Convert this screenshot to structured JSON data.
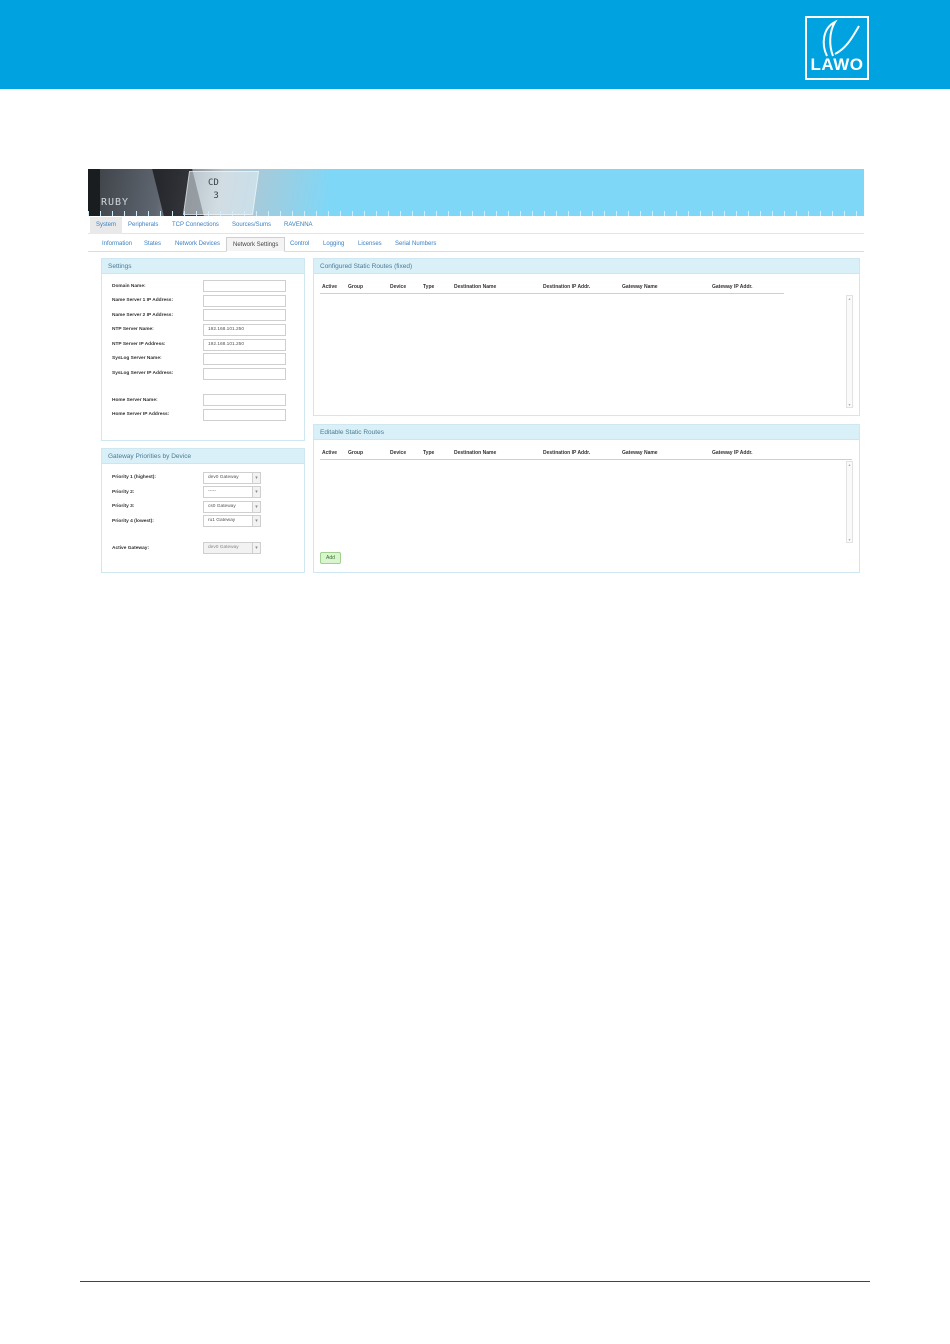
{
  "brand": {
    "logo_text": "LAWO",
    "band_color": "#00a3e0"
  },
  "banner": {
    "product": "RUBY",
    "photo_text_line1": "CD",
    "photo_text_line2": "3"
  },
  "main_tabs": [
    {
      "label": "System",
      "active": true
    },
    {
      "label": "Peripherals",
      "active": false
    },
    {
      "label": "TCP Connections",
      "active": false
    },
    {
      "label": "Sources/Sums",
      "active": false
    },
    {
      "label": "RAVENNA",
      "active": false
    }
  ],
  "sub_tabs": [
    {
      "label": "Information",
      "active": false
    },
    {
      "label": "States",
      "active": false
    },
    {
      "label": "Network Devices",
      "active": false
    },
    {
      "label": "Network Settings",
      "active": true
    },
    {
      "label": "Control",
      "active": false
    },
    {
      "label": "Logging",
      "active": false
    },
    {
      "label": "Licenses",
      "active": false
    },
    {
      "label": "Serial Numbers",
      "active": false
    }
  ],
  "settings": {
    "title": "Settings",
    "fields": [
      {
        "label": "Domain Name:",
        "value": ""
      },
      {
        "label": "Name Server 1 IP Address:",
        "value": ""
      },
      {
        "label": "Name Server 2 IP Address:",
        "value": ""
      },
      {
        "label": "NTP Server Name:",
        "value": "192.168.101.250"
      },
      {
        "label": "NTP Server IP Address:",
        "value": "192.168.101.250"
      },
      {
        "label": "SysLog Server Name:",
        "value": ""
      },
      {
        "label": "SysLog Server IP Address:",
        "value": ""
      },
      {
        "label": "Home Server Name:",
        "value": ""
      },
      {
        "label": "Home Server IP Address:",
        "value": ""
      }
    ]
  },
  "gateway": {
    "title": "Gateway Priorities by Device",
    "priorities": [
      {
        "label": "Priority 1 (highest):",
        "value": "dev0 Gateway"
      },
      {
        "label": "Priority 2:",
        "value": "-----"
      },
      {
        "label": "Priority 3:",
        "value": "cs0 Gateway"
      },
      {
        "label": "Priority 4 (lowest):",
        "value": "ru1 Gateway"
      }
    ],
    "active_label": "Active Gateway:",
    "active_value": "dev0 Gateway"
  },
  "configured_routes": {
    "title": "Configured Static Routes (fixed)",
    "columns": [
      "Active",
      "Group",
      "Device",
      "Type",
      "Destination Name",
      "Destination IP Addr.",
      "Gateway Name",
      "Gateway IP Addr."
    ]
  },
  "editable_routes": {
    "title": "Editable Static Routes",
    "columns": [
      "Active",
      "Group",
      "Device",
      "Type",
      "Destination Name",
      "Destination IP Addr.",
      "Gateway Name",
      "Gateway IP Addr."
    ],
    "add_label": "Add"
  }
}
